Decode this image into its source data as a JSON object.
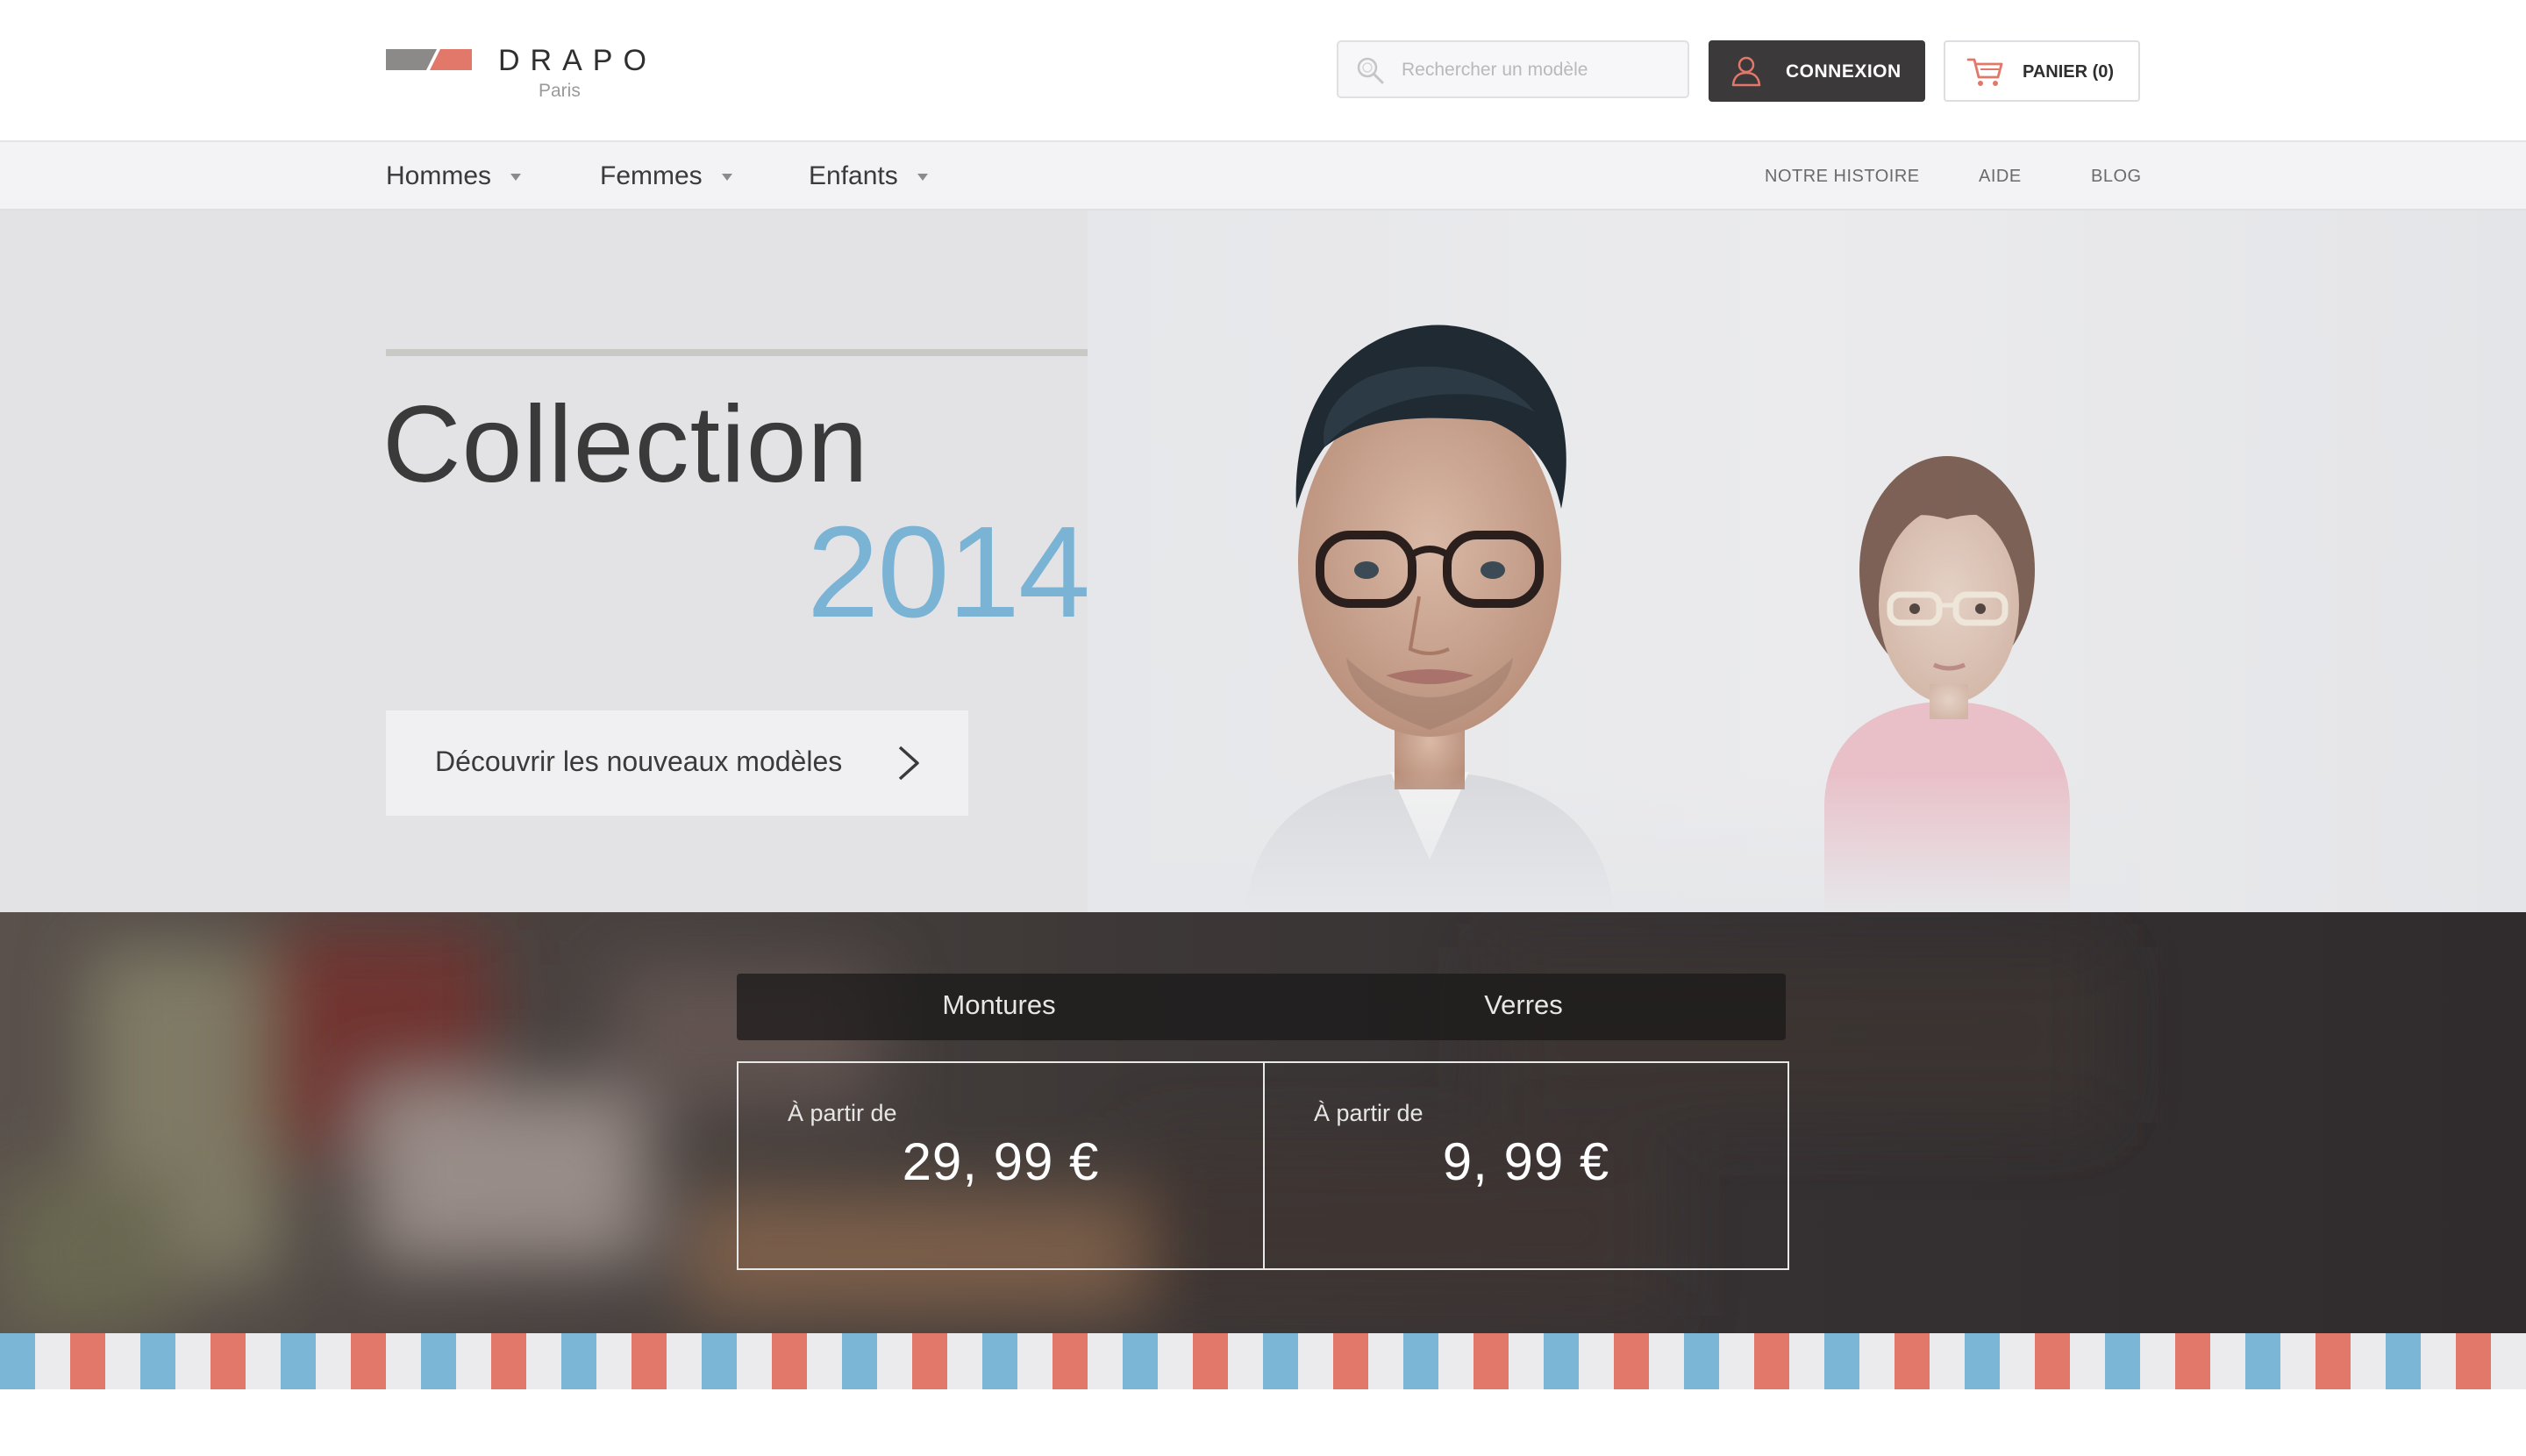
{
  "brand": {
    "name": "DRAPO",
    "city": "Paris",
    "colors": {
      "gray": "#8c8a88",
      "coral": "#e2786a",
      "blue": "#7bb6d6"
    }
  },
  "header": {
    "search": {
      "placeholder": "Rechercher un modèle",
      "icon": "search-icon"
    },
    "login": {
      "label": "CONNEXION",
      "icon": "user-icon"
    },
    "cart": {
      "label": "PANIER (0)",
      "icon": "cart-icon"
    }
  },
  "nav": {
    "categories": [
      {
        "label": "Hommes"
      },
      {
        "label": "Femmes"
      },
      {
        "label": "Enfants"
      }
    ],
    "links": [
      {
        "label": "NOTRE HISTOIRE"
      },
      {
        "label": "AIDE"
      },
      {
        "label": "BLOG"
      }
    ]
  },
  "hero": {
    "title": "Collection",
    "year": "2014",
    "cta": {
      "label": "Découvrir les nouveaux modèles",
      "icon": "chevron-right-icon"
    },
    "year_color": "#7ab3d4"
  },
  "pricing": {
    "tabs": [
      {
        "label": "Montures"
      },
      {
        "label": "Verres"
      }
    ],
    "boxes": [
      {
        "from": "À partir de",
        "amount": "29, 99 €"
      },
      {
        "from": "À partir de",
        "amount": "9, 99 €"
      }
    ]
  }
}
